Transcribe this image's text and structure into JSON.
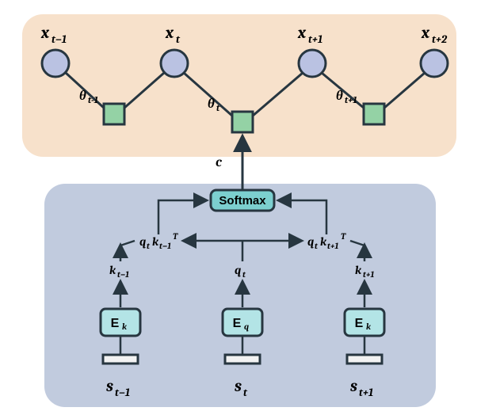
{
  "top_vars": {
    "x_tm1": {
      "base": "x",
      "sub": "t−1"
    },
    "x_t": {
      "base": "x",
      "sub": "t"
    },
    "x_tp1": {
      "base": "x",
      "sub": "t+1"
    },
    "x_tp2": {
      "base": "x",
      "sub": "t+2"
    }
  },
  "theta_labels": {
    "theta_tm1": {
      "base": "θ",
      "sub": "t-1"
    },
    "theta_t": {
      "base": "θ",
      "sub": "t"
    },
    "theta_tp1": {
      "base": "θ",
      "sub": "t+1"
    }
  },
  "c_label": "c",
  "softmax_label": "Softmax",
  "attn_terms": {
    "left": {
      "q": "q",
      "qsub": "t",
      "k": "k",
      "ksub": "t−1",
      "sup": "T"
    },
    "right": {
      "q": "q",
      "qsub": "t",
      "k": "k",
      "ksub": "t+1",
      "sup": "T"
    }
  },
  "proj_labels": {
    "k_tm1": {
      "base": "k",
      "sub": "t−1"
    },
    "q_t": {
      "base": "q",
      "sub": "t"
    },
    "k_tp1": {
      "base": "k",
      "sub": "t+1"
    }
  },
  "encoders": {
    "Ek_left": {
      "base": "E",
      "sub": "k"
    },
    "Eq": {
      "base": "E",
      "sub": "q"
    },
    "Ek_right": {
      "base": "E",
      "sub": "k"
    }
  },
  "state_vars": {
    "s_tm1": {
      "base": "s",
      "sub": "t−1"
    },
    "s_t": {
      "base": "s",
      "sub": "t"
    },
    "s_tp1": {
      "base": "s",
      "sub": "t+1"
    }
  },
  "colors": {
    "top_panel": "#F7E1CB",
    "bottom_panel": "#C1CBDE",
    "circle_fill": "#BAC2E2",
    "square_fill": "#94D2A5",
    "encoder_fill": "#B3E4E6",
    "softmax_fill": "#7CCFCF",
    "slot_fill": "#F2F2F2",
    "stroke": "#273640"
  }
}
